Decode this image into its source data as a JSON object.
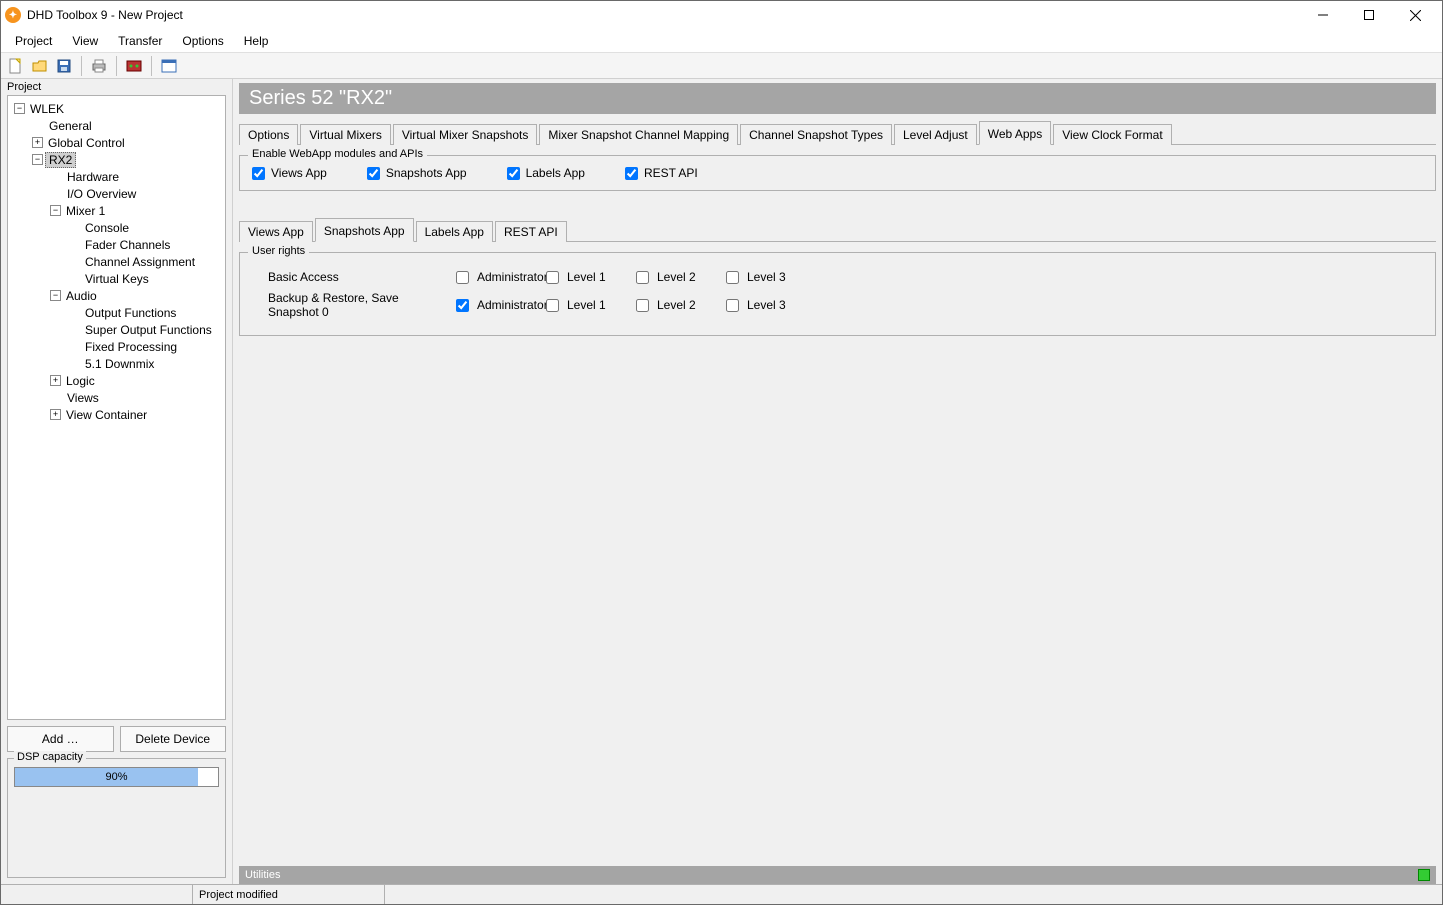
{
  "titlebar": {
    "title": "DHD Toolbox 9 - New Project"
  },
  "menu": {
    "project": "Project",
    "view": "View",
    "transfer": "Transfer",
    "options": "Options",
    "help": "Help"
  },
  "panel": {
    "title": "Project",
    "add": "Add …",
    "delete": "Delete Device",
    "dsp_label": "DSP capacity",
    "dsp_pct": "90%",
    "dsp_fill": 90
  },
  "tree": {
    "n0": "WLEK",
    "n1": "General",
    "n2": "Global Control",
    "n3": "RX2",
    "n4": "Hardware",
    "n5": "I/O Overview",
    "n6": "Mixer 1",
    "n7": "Console",
    "n8": "Fader Channels",
    "n9": "Channel Assignment",
    "n10": "Virtual Keys",
    "n11": "Audio",
    "n12": "Output Functions",
    "n13": "Super Output Functions",
    "n14": "Fixed Processing",
    "n15": "5.1 Downmix",
    "n16": "Logic",
    "n17": "Views",
    "n18": "View Container"
  },
  "header": {
    "series": "Series 52 \"RX2\""
  },
  "tabs": {
    "options": "Options",
    "vmixers": "Virtual Mixers",
    "vmsnap": "Virtual Mixer Snapshots",
    "mixmap": "Mixer Snapshot Channel Mapping",
    "chsnap": "Channel Snapshot Types",
    "level": "Level Adjust",
    "webapps": "Web Apps",
    "clock": "View Clock Format"
  },
  "fs1": {
    "legend": "Enable WebApp modules and APIs",
    "views": "Views App",
    "snaps": "Snapshots App",
    "labels": "Labels App",
    "rest": "REST API"
  },
  "subtabs": {
    "views": "Views App",
    "snaps": "Snapshots App",
    "labels": "Labels App",
    "rest": "REST API"
  },
  "rights": {
    "legend": "User rights",
    "basic": "Basic Access",
    "backup": "Backup & Restore, Save Snapshot 0",
    "admin": "Administrator",
    "l1": "Level 1",
    "l2": "Level 2",
    "l3": "Level 3"
  },
  "utilities": {
    "label": "Utilities"
  },
  "status": {
    "modified": "Project modified"
  }
}
